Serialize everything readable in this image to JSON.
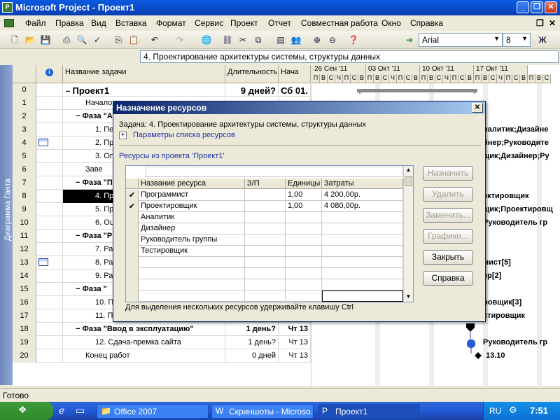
{
  "window": {
    "title": "Microsoft Project - Проект1",
    "app_icon": "project-icon"
  },
  "menu": [
    "Файл",
    "Правка",
    "Вид",
    "Вставка",
    "Формат",
    "Сервис",
    "Проект",
    "Отчет",
    "Совместная работа",
    "Окно",
    "Справка"
  ],
  "toolbar": {
    "font": "Arial",
    "font_size": "8",
    "bold_label": "Ж"
  },
  "entry_bar": {
    "value": "4. Проектирование архитектуры системы, структуры данных"
  },
  "view_bar": {
    "label": "Диаграмма Ганта"
  },
  "grid": {
    "headers": {
      "name": "Название задачи",
      "duration": "Длительность",
      "start": "Нача"
    },
    "rows": [
      {
        "id": "0",
        "name": "Проект1",
        "duration": "9 дней?",
        "start": "Сб 01.",
        "bold": true,
        "indent": 0,
        "collapse": "−"
      },
      {
        "id": "1",
        "name": "Начало",
        "duration": "",
        "start": "",
        "bold": false,
        "indent": 2,
        "collapse": ""
      },
      {
        "id": "2",
        "name": "Фаза \"Анализ\"",
        "duration": "",
        "start": "",
        "bold": true,
        "indent": 1,
        "collapse": "−"
      },
      {
        "id": "3",
        "name": "1. Пе",
        "duration": "",
        "start": "",
        "bold": false,
        "indent": 3,
        "collapse": ""
      },
      {
        "id": "4",
        "name": "2. Пр",
        "duration": "",
        "start": "",
        "bold": false,
        "indent": 3,
        "collapse": "",
        "icon": true
      },
      {
        "id": "5",
        "name": "3. Оп",
        "duration": "",
        "start": "",
        "bold": false,
        "indent": 3,
        "collapse": ""
      },
      {
        "id": "6",
        "name": "Заве",
        "duration": "",
        "start": "",
        "bold": false,
        "indent": 2,
        "collapse": ""
      },
      {
        "id": "7",
        "name": "Фаза \"П",
        "duration": "",
        "start": "",
        "bold": true,
        "indent": 1,
        "collapse": "−"
      },
      {
        "id": "8",
        "name": "4. Пр",
        "duration": "",
        "start": "",
        "bold": false,
        "indent": 3,
        "collapse": "",
        "selected": true
      },
      {
        "id": "9",
        "name": "5. Пр",
        "duration": "",
        "start": "",
        "bold": false,
        "indent": 3,
        "collapse": ""
      },
      {
        "id": "10",
        "name": "6. Оц",
        "duration": "",
        "start": "",
        "bold": false,
        "indent": 3,
        "collapse": ""
      },
      {
        "id": "11",
        "name": "Фаза \"Р",
        "duration": "",
        "start": "",
        "bold": true,
        "indent": 1,
        "collapse": "−"
      },
      {
        "id": "12",
        "name": "7. Ра",
        "duration": "",
        "start": "",
        "bold": false,
        "indent": 3,
        "collapse": ""
      },
      {
        "id": "13",
        "name": "8. Ра",
        "duration": "",
        "start": "",
        "bold": false,
        "indent": 3,
        "collapse": "",
        "icon": true
      },
      {
        "id": "14",
        "name": "9. Ра",
        "duration": "",
        "start": "",
        "bold": false,
        "indent": 3,
        "collapse": ""
      },
      {
        "id": "15",
        "name": "Фаза \"",
        "duration": "",
        "start": "",
        "bold": true,
        "indent": 1,
        "collapse": "−"
      },
      {
        "id": "16",
        "name": "10. П",
        "duration": "",
        "start": "",
        "bold": false,
        "indent": 3,
        "collapse": ""
      },
      {
        "id": "17",
        "name": "11. П",
        "duration": "",
        "start": "",
        "bold": false,
        "indent": 3,
        "collapse": ""
      },
      {
        "id": "18",
        "name": "Фаза \"Ввод в эксплуатацию\"",
        "duration": "1 день?",
        "start": "Чт 13",
        "bold": true,
        "indent": 1,
        "collapse": "−"
      },
      {
        "id": "19",
        "name": "12. Сдача-премка сайта",
        "duration": "1 день?",
        "start": "Чт 13",
        "bold": false,
        "indent": 3,
        "collapse": ""
      },
      {
        "id": "20",
        "name": "Конец работ",
        "duration": "0 дней",
        "start": "Чт 13",
        "bold": false,
        "indent": 2,
        "collapse": ""
      }
    ]
  },
  "gantt": {
    "weeks": [
      "26 Сен '11",
      "03 Окт '11",
      "10 Окт '11",
      "17 Окт '11"
    ],
    "days": [
      "П",
      "В",
      "С",
      "Ч",
      "П",
      "С",
      "В",
      "П",
      "В",
      "С",
      "Ч",
      "П",
      "С",
      "В",
      "П",
      "В",
      "С",
      "Ч",
      "П",
      "С",
      "В",
      "П",
      "В",
      "С",
      "Ч",
      "П",
      "С",
      "В",
      "П",
      "В",
      "С"
    ],
    "labels": [
      {
        "row": 3,
        "text": "налитик;Дизайне"
      },
      {
        "row": 4,
        "text": "йнер;Руководите"
      },
      {
        "row": 5,
        "text": "щик;Дизайнер;Ру"
      },
      {
        "row": 8,
        "text": "ектировщик"
      },
      {
        "row": 9,
        "text": "щик;Проектировщ"
      },
      {
        "row": 10,
        "text": "Руководитель гр"
      },
      {
        "row": 12,
        "text": "]"
      },
      {
        "row": 13,
        "text": "мист[5]"
      },
      {
        "row": 14,
        "text": "ер[2]"
      },
      {
        "row": 16,
        "text": "ровщик[3]"
      },
      {
        "row": 17,
        "text": "стировщик"
      },
      {
        "row": 19,
        "text": "Руководитель гр"
      },
      {
        "row": 20,
        "text": "13.10"
      }
    ]
  },
  "dialog": {
    "title": "Назначение ресурсов",
    "task_label": "Задача: 4. Проектирование архитектуры системы, структуры данных",
    "params_label": "Параметры списка ресурсов",
    "resources_label": "Ресурсы из проекта 'Проект1'",
    "columns": [
      "Название ресурса",
      "З/П",
      "Единицы",
      "Затраты"
    ],
    "resources": [
      {
        "check": "✔",
        "name": "Программист",
        "zp": "",
        "units": "1,00",
        "cost": "4 200,00р."
      },
      {
        "check": "✔",
        "name": "Проектировщик",
        "zp": "",
        "units": "1,00",
        "cost": "4 080,00р."
      },
      {
        "check": "",
        "name": "Аналитик",
        "zp": "",
        "units": "",
        "cost": ""
      },
      {
        "check": "",
        "name": "Дизайнер",
        "zp": "",
        "units": "",
        "cost": ""
      },
      {
        "check": "",
        "name": "Руководитель группы",
        "zp": "",
        "units": "",
        "cost": ""
      },
      {
        "check": "",
        "name": "Тестировщик",
        "zp": "",
        "units": "",
        "cost": ""
      },
      {
        "check": "",
        "name": "",
        "zp": "",
        "units": "",
        "cost": ""
      },
      {
        "check": "",
        "name": "",
        "zp": "",
        "units": "",
        "cost": ""
      },
      {
        "check": "",
        "name": "",
        "zp": "",
        "units": "",
        "cost": ""
      },
      {
        "check": "",
        "name": "",
        "zp": "",
        "units": "",
        "cost": ""
      }
    ],
    "buttons": {
      "assign": "Назначить",
      "remove": "Удалить",
      "replace": "Заменить...",
      "graphs": "Графики...",
      "close": "Закрыть",
      "help": "Справка"
    },
    "hint": "Для выделения нескольких ресурсов удерживайте клавишу Ctrl"
  },
  "status": {
    "text": "Готово"
  },
  "taskbar": {
    "items": [
      {
        "label": "Office 2007",
        "icon": "folder-icon"
      },
      {
        "label": "Скриншоты - Microso...",
        "icon": "word-icon"
      },
      {
        "label": "Проект1",
        "icon": "project-icon",
        "active": true
      }
    ],
    "lang": "RU",
    "clock": "7:51"
  },
  "colors": {
    "title_blue": "#0a5be0",
    "bar_blue": "#2a5bdc",
    "summary_bar": "#7f7f7f"
  }
}
